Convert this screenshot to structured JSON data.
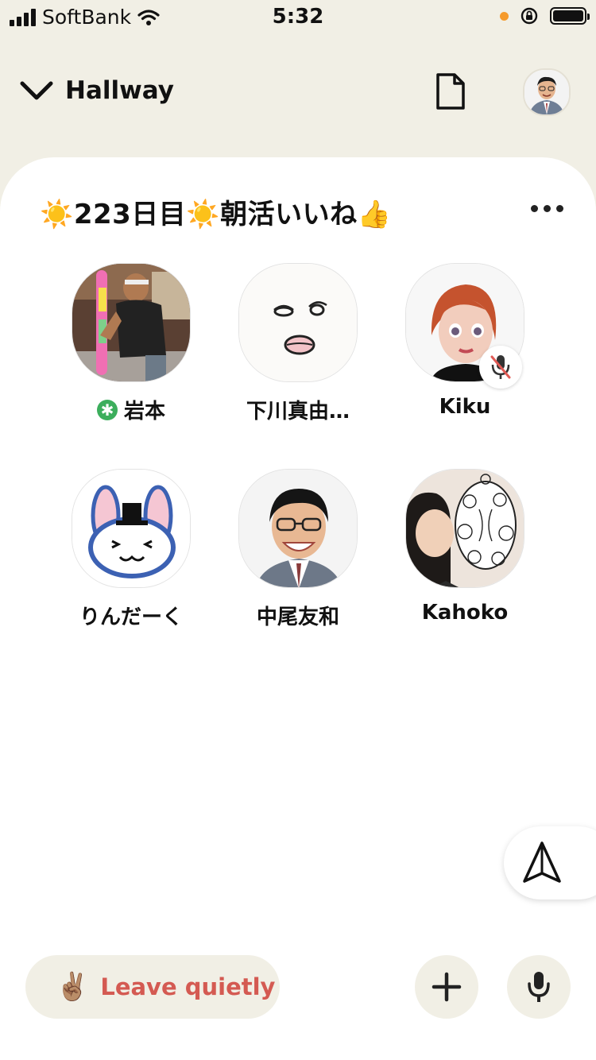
{
  "status_bar": {
    "carrier": "SoftBank",
    "time": "5:32",
    "icons": [
      "signal-icon",
      "wifi-icon",
      "orientation-lock-icon",
      "battery-icon"
    ]
  },
  "header": {
    "back_icon": "chevron-down-icon",
    "title": "Hallway",
    "doc_icon": "document-icon"
  },
  "room": {
    "title": "☀️223日目☀️朝活いいね👍",
    "more_icon": "more-horizontal-icon"
  },
  "speakers": [
    {
      "name": "岩本",
      "moderator": true,
      "muted": false
    },
    {
      "name": "下川真由…",
      "moderator": false,
      "muted": false
    },
    {
      "name": "Kiku",
      "moderator": false,
      "muted": true
    },
    {
      "name": "りんだーく",
      "moderator": false,
      "muted": false
    },
    {
      "name": "中尾友和",
      "moderator": false,
      "muted": false
    },
    {
      "name": "Kahoko",
      "moderator": false,
      "muted": false
    }
  ],
  "footer": {
    "leave_emoji": "✌🏽",
    "leave_label": "Leave quietly",
    "add_icon": "plus-icon",
    "mic_icon": "microphone-icon",
    "share_icon": "paper-plane-icon"
  },
  "colors": {
    "background": "#f1efe5",
    "sheet": "#ffffff",
    "leave_text": "#d45a52",
    "moderator_badge": "#3cae5c"
  }
}
